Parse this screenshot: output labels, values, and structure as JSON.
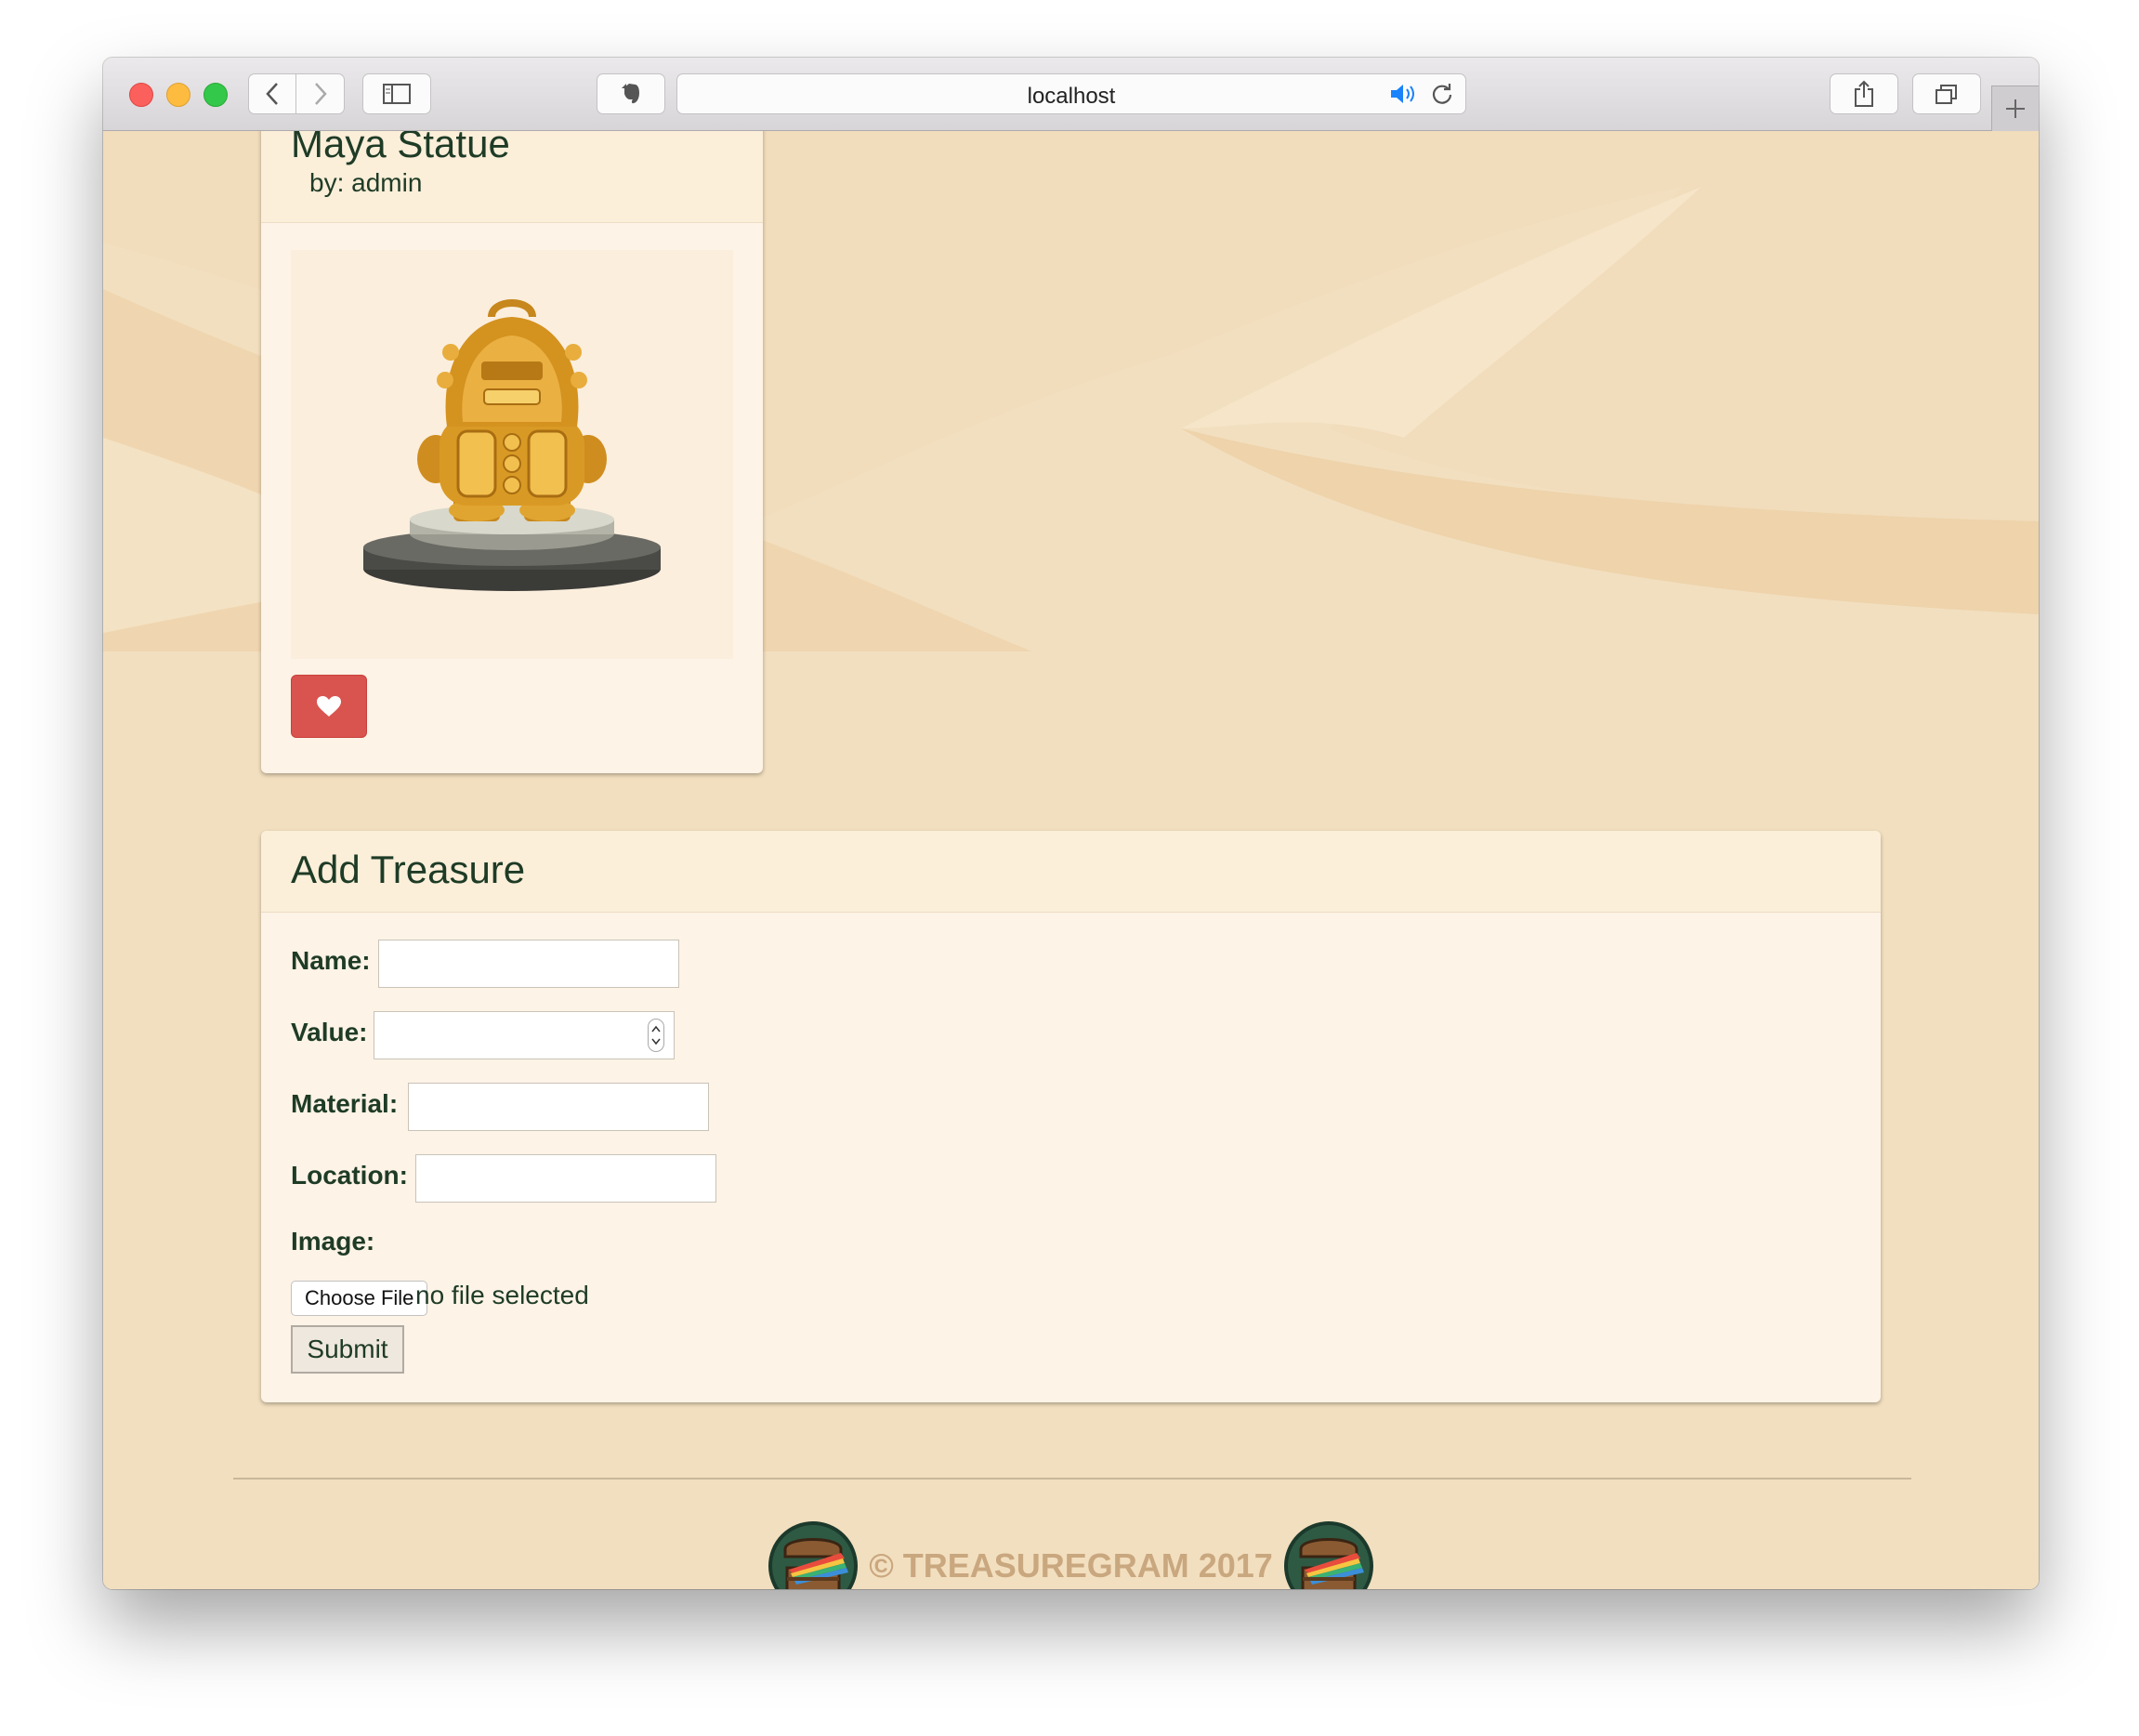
{
  "browser": {
    "url": "localhost"
  },
  "treasure_card": {
    "title": "Maya Statue",
    "author": "by: admin",
    "image_alt": "Maya Statue"
  },
  "add_treasure": {
    "title": "Add Treasure",
    "name_label": "Name:",
    "value_label": "Value:",
    "material_label": "Material:",
    "location_label": "Location:",
    "image_label": "Image:",
    "choose_file": "Choose File",
    "file_status": "no file selected",
    "submit": "Submit"
  },
  "footer": {
    "text": "© TREASUREGRAM 2017"
  },
  "colors": {
    "background": "#f2dfbf",
    "heading_text": "#1e3b26",
    "like_button": "#d9534f",
    "footer_text": "#c9a77f"
  }
}
